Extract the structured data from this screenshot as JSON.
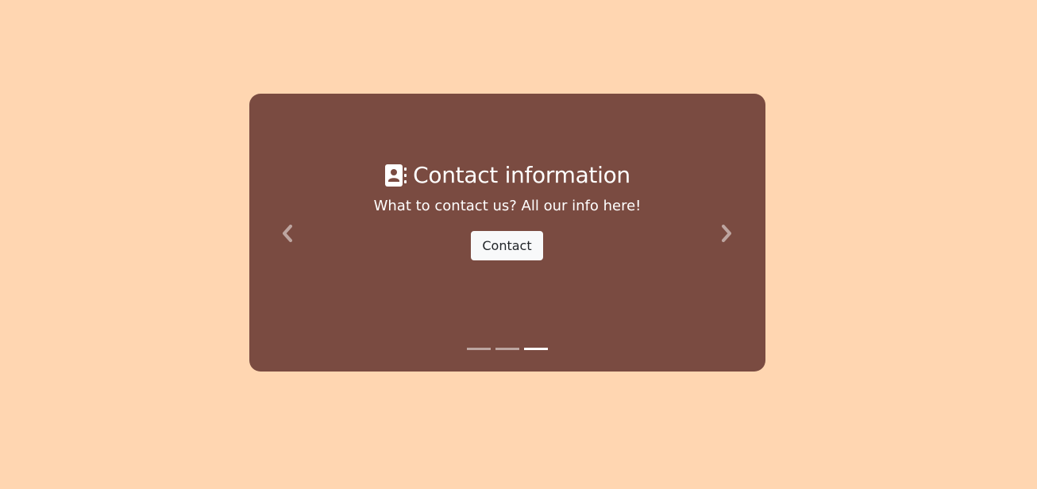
{
  "slide": {
    "icon": "address-book-icon",
    "title": "Contact information",
    "subtitle": "What to contact us? All our info here!",
    "button_label": "Contact"
  },
  "carousel": {
    "prev_icon": "chevron-left-icon",
    "next_icon": "chevron-right-icon",
    "slide_count": 3,
    "active_index": 2
  },
  "colors": {
    "page_background": "#FFD6B1",
    "carousel_background": "#7A4B41",
    "text": "#FFFFFF",
    "button_background": "#F8F9FA",
    "button_text": "#212529"
  }
}
